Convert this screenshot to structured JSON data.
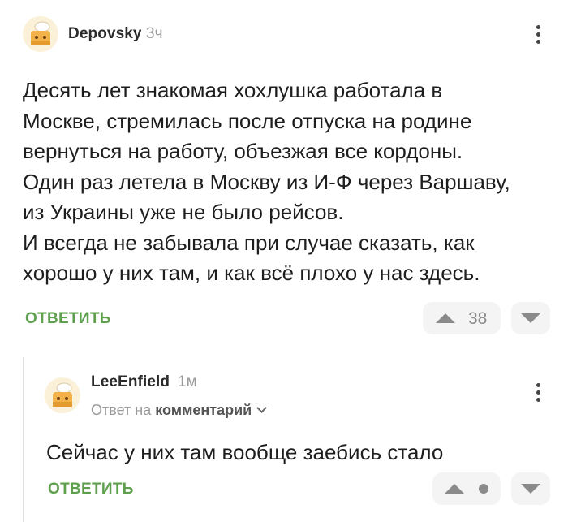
{
  "comment": {
    "username": "Depovsky",
    "time": "3ч",
    "body_lines": [
      "Десять лет знакомая хохлушка работала в",
      "Москве, стремилась после отпуска на родине",
      "вернуться на работу, объезжая все кордоны.",
      "Один раз летела в Москву из И-Ф через Варшаву,",
      "из Украины уже не было рейсов.",
      "И всегда не забывала при случае сказать, как",
      "хорошо у них там, и как всё плохо у нас здесь."
    ],
    "reply_label": "ОТВЕТИТЬ",
    "rating": "38"
  },
  "reply": {
    "username": "LeeEnfield",
    "time": "1м",
    "reply_to_prefix": "Ответ на",
    "reply_to_target": "комментарий",
    "body": "Сейчас у них там вообще заебись стало",
    "reply_label": "ОТВЕТИТЬ"
  },
  "colors": {
    "accent_green": "#5fa04e",
    "muted": "#9a9a9a",
    "vote_bg": "#f4f4f4"
  },
  "icons": [
    "avatar-icon",
    "kebab-menu-icon",
    "upvote-icon",
    "downvote-icon",
    "chevron-down-icon",
    "rating-hidden-dot-icon"
  ]
}
